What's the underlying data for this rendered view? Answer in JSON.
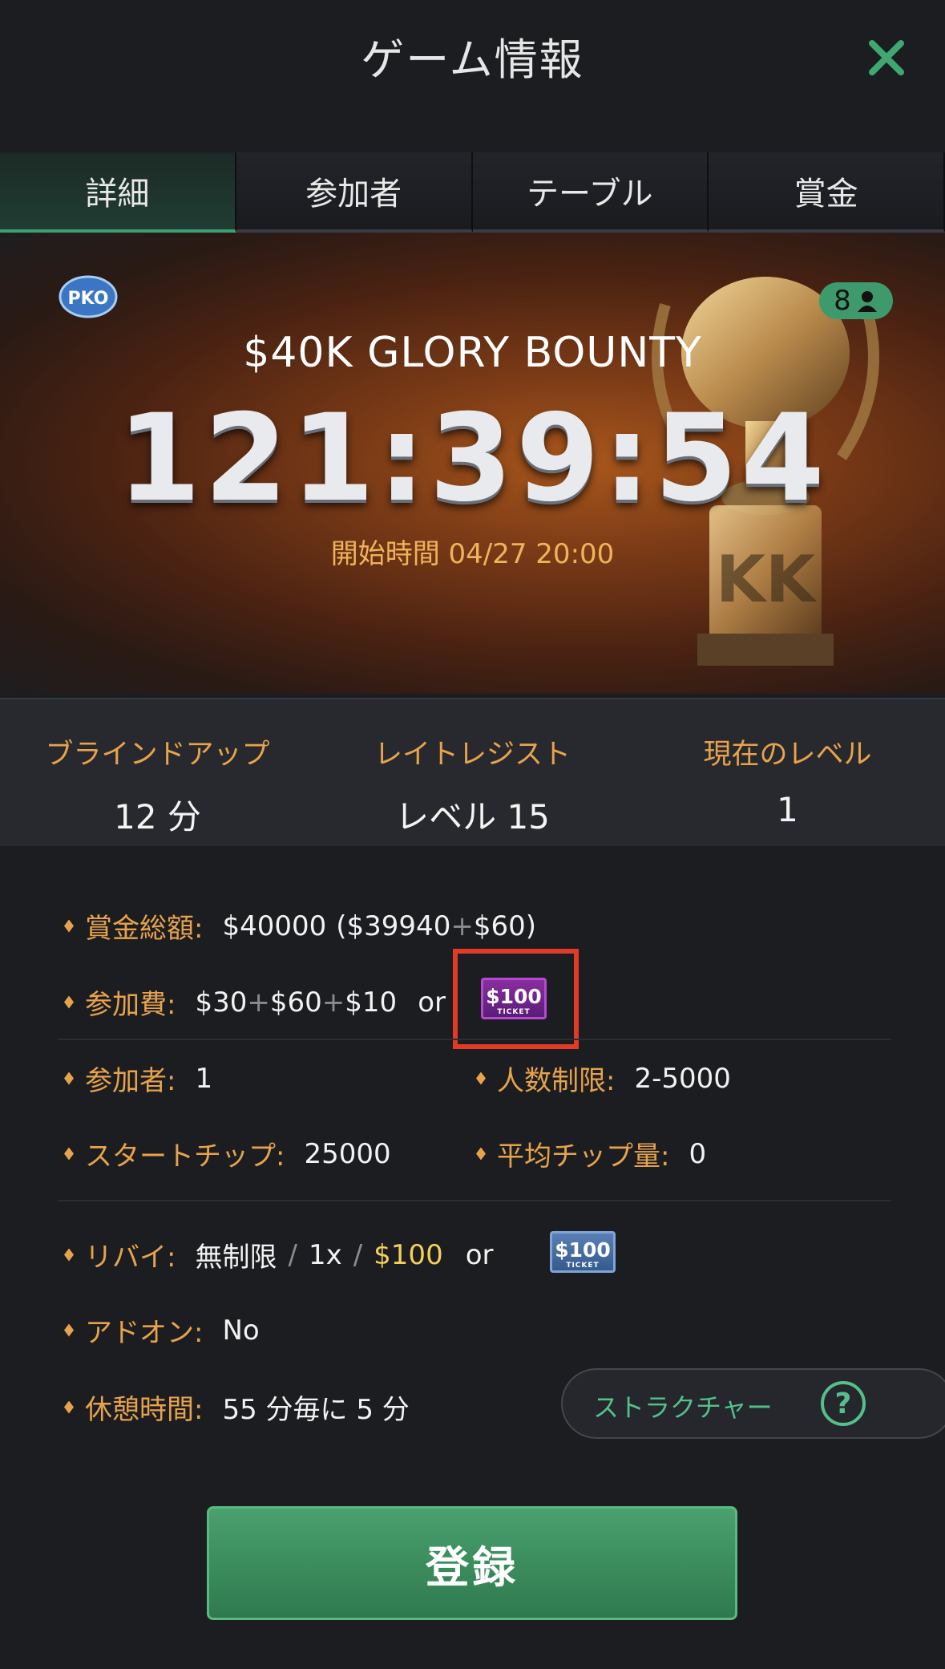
{
  "header": {
    "title": "ゲーム情報"
  },
  "tabs": [
    {
      "label": "詳細",
      "active": true
    },
    {
      "label": "参加者",
      "active": false
    },
    {
      "label": "テーブル",
      "active": false
    },
    {
      "label": "賞金",
      "active": false
    }
  ],
  "banner": {
    "badge": "PKO",
    "player_count": "8",
    "tournament_name": "$40K GLORY BOUNTY",
    "countdown": "121:39:54",
    "start_time": "開始時間 04/27 20:00"
  },
  "stats": [
    {
      "label": "ブラインドアップ",
      "value": "12 分"
    },
    {
      "label": "レイトレジスト",
      "value": "レベル 15"
    },
    {
      "label": "現在のレベル",
      "value": "1"
    }
  ],
  "info": {
    "prize_pool": {
      "label": "賞金総額:",
      "value": "$40000",
      "paren_open": "($39940",
      "plus": "+",
      "paren_close": "$60)"
    },
    "buy_in": {
      "label": "参加費:",
      "a": "$30",
      "plus1": "+",
      "b": "$60",
      "plus2": "+",
      "c": "$10",
      "or": "or",
      "ticket": "$100",
      "ticket_sub": "TICKET"
    },
    "entrants": {
      "label": "参加者:",
      "value": "1"
    },
    "limit": {
      "label": "人数制限:",
      "value": "2-5000"
    },
    "start_chips": {
      "label": "スタートチップ:",
      "value": "25000"
    },
    "avg_chips": {
      "label": "平均チップ量:",
      "value": "0"
    },
    "rebuy": {
      "label": "リバイ:",
      "v1": "無制限",
      "sep": "/",
      "v2": "1x",
      "sep2": "/",
      "v3": "$100",
      "or": "or",
      "ticket": "$100",
      "ticket_sub": "TICKET"
    },
    "addon": {
      "label": "アドオン:",
      "value": "No"
    },
    "break": {
      "label": "休憩時間:",
      "value": "55 分毎に 5 分"
    }
  },
  "structure_button": {
    "label": "ストラクチャー",
    "help": "?"
  },
  "register_button": {
    "label": "登録"
  },
  "colors": {
    "accent_green": "#3e9f72",
    "label_orange": "#e7a34c",
    "highlight_red": "#e33a25"
  }
}
